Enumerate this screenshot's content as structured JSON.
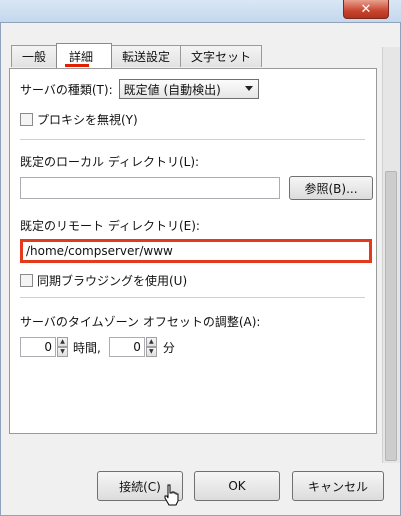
{
  "window": {
    "close_glyph": "✕"
  },
  "tabs": [
    {
      "label": "一般",
      "active": false
    },
    {
      "label": "詳細",
      "active": true
    },
    {
      "label": "転送設定",
      "active": false
    },
    {
      "label": "文字セット",
      "active": false
    }
  ],
  "server_type": {
    "label": "サーバの種類(T):",
    "value": "既定値 (自動検出)"
  },
  "proxy_bypass": {
    "label": "プロキシを無視(Y)",
    "checked": false
  },
  "local_dir": {
    "label": "既定のローカル ディレクトリ(L):",
    "value": "",
    "browse_label": "参照(B)..."
  },
  "remote_dir": {
    "label": "既定のリモート ディレクトリ(E):",
    "value": "/home/compserver/www"
  },
  "sync_browse": {
    "label": "同期ブラウジングを使用(U)",
    "checked": false
  },
  "timezone": {
    "label": "サーバのタイムゾーン オフセットの調整(A):",
    "hours_value": "0",
    "hours_unit": "時間,",
    "minutes_value": "0",
    "minutes_unit": "分"
  },
  "buttons": {
    "connect": "接続(C)",
    "ok": "OK",
    "cancel": "キャンセル"
  },
  "colors": {
    "highlight": "#e23a1a",
    "tab_underline": "#e02000"
  }
}
